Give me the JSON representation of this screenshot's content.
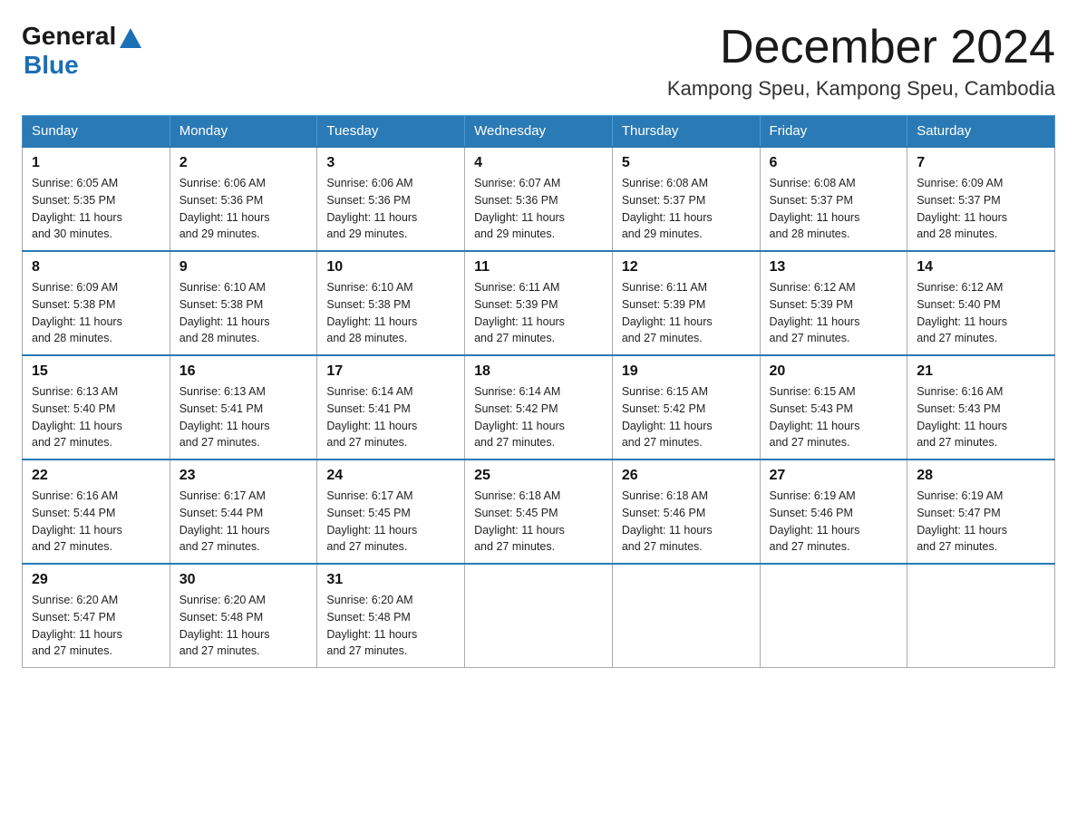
{
  "logo": {
    "general": "General",
    "blue": "Blue"
  },
  "title": "December 2024",
  "location": "Kampong Speu, Kampong Speu, Cambodia",
  "weekdays": [
    "Sunday",
    "Monday",
    "Tuesday",
    "Wednesday",
    "Thursday",
    "Friday",
    "Saturday"
  ],
  "weeks": [
    [
      {
        "day": "1",
        "sunrise": "6:05 AM",
        "sunset": "5:35 PM",
        "daylight": "11 hours and 30 minutes."
      },
      {
        "day": "2",
        "sunrise": "6:06 AM",
        "sunset": "5:36 PM",
        "daylight": "11 hours and 29 minutes."
      },
      {
        "day": "3",
        "sunrise": "6:06 AM",
        "sunset": "5:36 PM",
        "daylight": "11 hours and 29 minutes."
      },
      {
        "day": "4",
        "sunrise": "6:07 AM",
        "sunset": "5:36 PM",
        "daylight": "11 hours and 29 minutes."
      },
      {
        "day": "5",
        "sunrise": "6:08 AM",
        "sunset": "5:37 PM",
        "daylight": "11 hours and 29 minutes."
      },
      {
        "day": "6",
        "sunrise": "6:08 AM",
        "sunset": "5:37 PM",
        "daylight": "11 hours and 28 minutes."
      },
      {
        "day": "7",
        "sunrise": "6:09 AM",
        "sunset": "5:37 PM",
        "daylight": "11 hours and 28 minutes."
      }
    ],
    [
      {
        "day": "8",
        "sunrise": "6:09 AM",
        "sunset": "5:38 PM",
        "daylight": "11 hours and 28 minutes."
      },
      {
        "day": "9",
        "sunrise": "6:10 AM",
        "sunset": "5:38 PM",
        "daylight": "11 hours and 28 minutes."
      },
      {
        "day": "10",
        "sunrise": "6:10 AM",
        "sunset": "5:38 PM",
        "daylight": "11 hours and 28 minutes."
      },
      {
        "day": "11",
        "sunrise": "6:11 AM",
        "sunset": "5:39 PM",
        "daylight": "11 hours and 27 minutes."
      },
      {
        "day": "12",
        "sunrise": "6:11 AM",
        "sunset": "5:39 PM",
        "daylight": "11 hours and 27 minutes."
      },
      {
        "day": "13",
        "sunrise": "6:12 AM",
        "sunset": "5:39 PM",
        "daylight": "11 hours and 27 minutes."
      },
      {
        "day": "14",
        "sunrise": "6:12 AM",
        "sunset": "5:40 PM",
        "daylight": "11 hours and 27 minutes."
      }
    ],
    [
      {
        "day": "15",
        "sunrise": "6:13 AM",
        "sunset": "5:40 PM",
        "daylight": "11 hours and 27 minutes."
      },
      {
        "day": "16",
        "sunrise": "6:13 AM",
        "sunset": "5:41 PM",
        "daylight": "11 hours and 27 minutes."
      },
      {
        "day": "17",
        "sunrise": "6:14 AM",
        "sunset": "5:41 PM",
        "daylight": "11 hours and 27 minutes."
      },
      {
        "day": "18",
        "sunrise": "6:14 AM",
        "sunset": "5:42 PM",
        "daylight": "11 hours and 27 minutes."
      },
      {
        "day": "19",
        "sunrise": "6:15 AM",
        "sunset": "5:42 PM",
        "daylight": "11 hours and 27 minutes."
      },
      {
        "day": "20",
        "sunrise": "6:15 AM",
        "sunset": "5:43 PM",
        "daylight": "11 hours and 27 minutes."
      },
      {
        "day": "21",
        "sunrise": "6:16 AM",
        "sunset": "5:43 PM",
        "daylight": "11 hours and 27 minutes."
      }
    ],
    [
      {
        "day": "22",
        "sunrise": "6:16 AM",
        "sunset": "5:44 PM",
        "daylight": "11 hours and 27 minutes."
      },
      {
        "day": "23",
        "sunrise": "6:17 AM",
        "sunset": "5:44 PM",
        "daylight": "11 hours and 27 minutes."
      },
      {
        "day": "24",
        "sunrise": "6:17 AM",
        "sunset": "5:45 PM",
        "daylight": "11 hours and 27 minutes."
      },
      {
        "day": "25",
        "sunrise": "6:18 AM",
        "sunset": "5:45 PM",
        "daylight": "11 hours and 27 minutes."
      },
      {
        "day": "26",
        "sunrise": "6:18 AM",
        "sunset": "5:46 PM",
        "daylight": "11 hours and 27 minutes."
      },
      {
        "day": "27",
        "sunrise": "6:19 AM",
        "sunset": "5:46 PM",
        "daylight": "11 hours and 27 minutes."
      },
      {
        "day": "28",
        "sunrise": "6:19 AM",
        "sunset": "5:47 PM",
        "daylight": "11 hours and 27 minutes."
      }
    ],
    [
      {
        "day": "29",
        "sunrise": "6:20 AM",
        "sunset": "5:47 PM",
        "daylight": "11 hours and 27 minutes."
      },
      {
        "day": "30",
        "sunrise": "6:20 AM",
        "sunset": "5:48 PM",
        "daylight": "11 hours and 27 minutes."
      },
      {
        "day": "31",
        "sunrise": "6:20 AM",
        "sunset": "5:48 PM",
        "daylight": "11 hours and 27 minutes."
      },
      null,
      null,
      null,
      null
    ]
  ]
}
